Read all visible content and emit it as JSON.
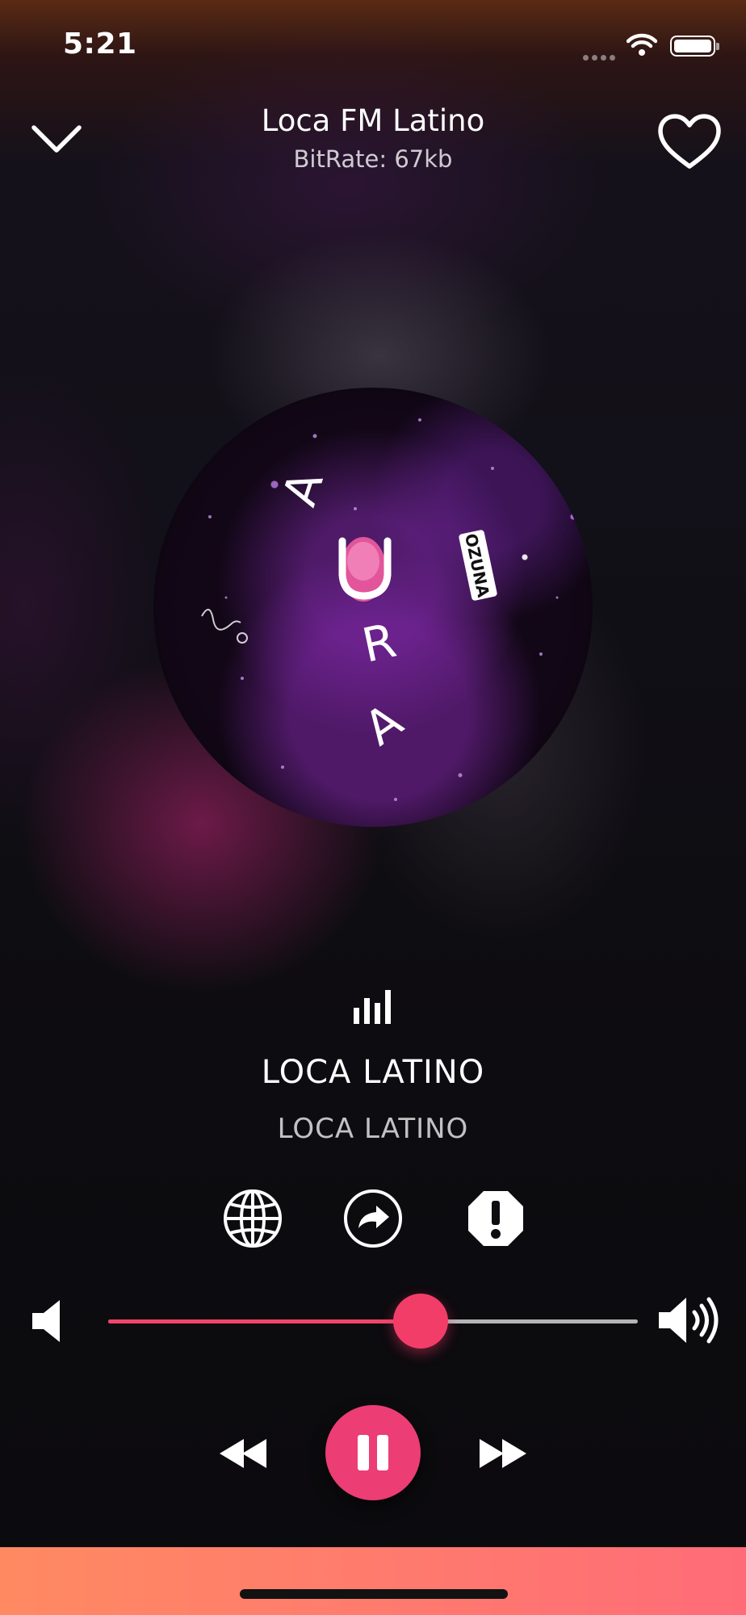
{
  "status_bar": {
    "time": "5:21"
  },
  "header": {
    "station_name": "Loca FM Latino",
    "bitrate": "BitRate: 67kb"
  },
  "now_playing": {
    "song_title": "LOCA LATINO",
    "artist": "LOCA LATINO"
  },
  "artwork": {
    "letters": [
      "A",
      "U",
      "R",
      "A"
    ],
    "badge_text": "OZUNA"
  },
  "volume": {
    "level": 0.59
  },
  "colors": {
    "accent": "#f33d69",
    "play_button": "#ec3d74",
    "track": "#b5b5b5",
    "bottom_bar_start": "#ff8a62",
    "bottom_bar_end": "#ff6c78"
  },
  "icons": {
    "collapse": "chevron-down-icon",
    "favorite": "heart-icon",
    "equalizer": "equalizer-bars-icon",
    "website": "globe-icon",
    "share": "share-icon",
    "report": "report-icon",
    "volume_low": "volume-low-icon",
    "volume_high": "volume-high-icon",
    "rewind": "rewind-icon",
    "pause": "pause-icon",
    "forward": "fast-forward-icon"
  }
}
